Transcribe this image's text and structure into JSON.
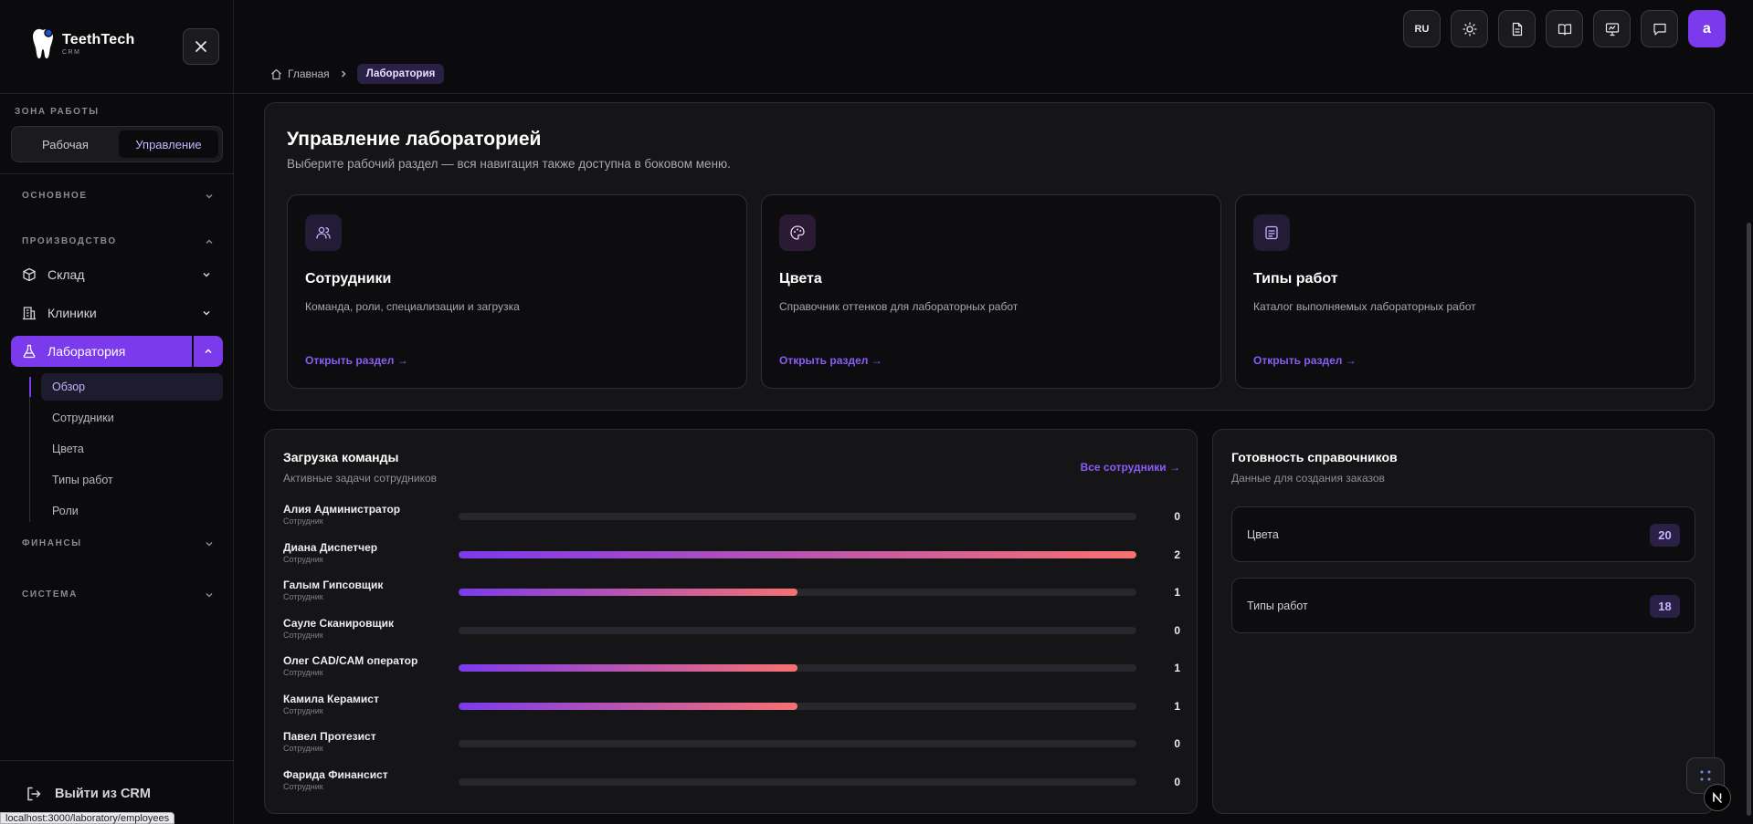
{
  "app": {
    "name": "TeethTech",
    "sub": "CRM"
  },
  "sidebar": {
    "zone_label": "ЗОНА РАБОТЫ",
    "zone_options": [
      "Рабочая",
      "Управление"
    ],
    "sections": {
      "basic": "ОСНОВНОЕ",
      "production": "ПРОИЗВОДСТВО",
      "finance": "ФИНАНСЫ",
      "system": "СИСТЕМА"
    },
    "items": {
      "warehouse": "Склад",
      "clinics": "Клиники",
      "laboratory": "Лаборатория"
    },
    "lab_sub": [
      "Обзор",
      "Сотрудники",
      "Цвета",
      "Типы работ",
      "Роли"
    ],
    "logout": "Выйти из CRM"
  },
  "status_url": "localhost:3000/laboratory/employees",
  "breadcrumb": {
    "home": "Главная",
    "current": "Лаборатория"
  },
  "topbar": {
    "lang": "RU",
    "avatar": "a"
  },
  "main": {
    "title": "Управление лабораторией",
    "subtitle": "Выберите рабочий раздел — вся навигация также доступна в боковом меню.",
    "cards": [
      {
        "title": "Сотрудники",
        "desc": "Команда, роли, специализации и загрузка",
        "link": "Открыть раздел  →",
        "icon": "users-icon"
      },
      {
        "title": "Цвета",
        "desc": "Справочник оттенков для лабораторных работ",
        "link": "Открыть раздел  →",
        "icon": "palette-icon"
      },
      {
        "title": "Типы работ",
        "desc": "Каталог выполняемых лабораторных работ",
        "link": "Открыть раздел  →",
        "icon": "list-icon"
      }
    ]
  },
  "team_load": {
    "title": "Загрузка команды",
    "subtitle": "Активные задачи сотрудников",
    "link": "Все сотрудники →",
    "max": 2,
    "employees": [
      {
        "name": "Алия Администратор",
        "role": "Сотрудник",
        "count": 0
      },
      {
        "name": "Диана Диспетчер",
        "role": "Сотрудник",
        "count": 2
      },
      {
        "name": "Галым Гипсовщик",
        "role": "Сотрудник",
        "count": 1
      },
      {
        "name": "Сауле Сканировщик",
        "role": "Сотрудник",
        "count": 0
      },
      {
        "name": "Олег CAD/CAM оператор",
        "role": "Сотрудник",
        "count": 1
      },
      {
        "name": "Камила Керамист",
        "role": "Сотрудник",
        "count": 1
      },
      {
        "name": "Павел Протезист",
        "role": "Сотрудник",
        "count": 0
      },
      {
        "name": "Фарида Финансист",
        "role": "Сотрудник",
        "count": 0
      }
    ]
  },
  "readiness": {
    "title": "Готовность справочников",
    "subtitle": "Данные для создания заказов",
    "items": [
      {
        "label": "Цвета",
        "value": "20"
      },
      {
        "label": "Типы работ",
        "value": "18"
      }
    ]
  },
  "colors": {
    "accent": "#7c3aed",
    "bar_end": "#f87171"
  }
}
